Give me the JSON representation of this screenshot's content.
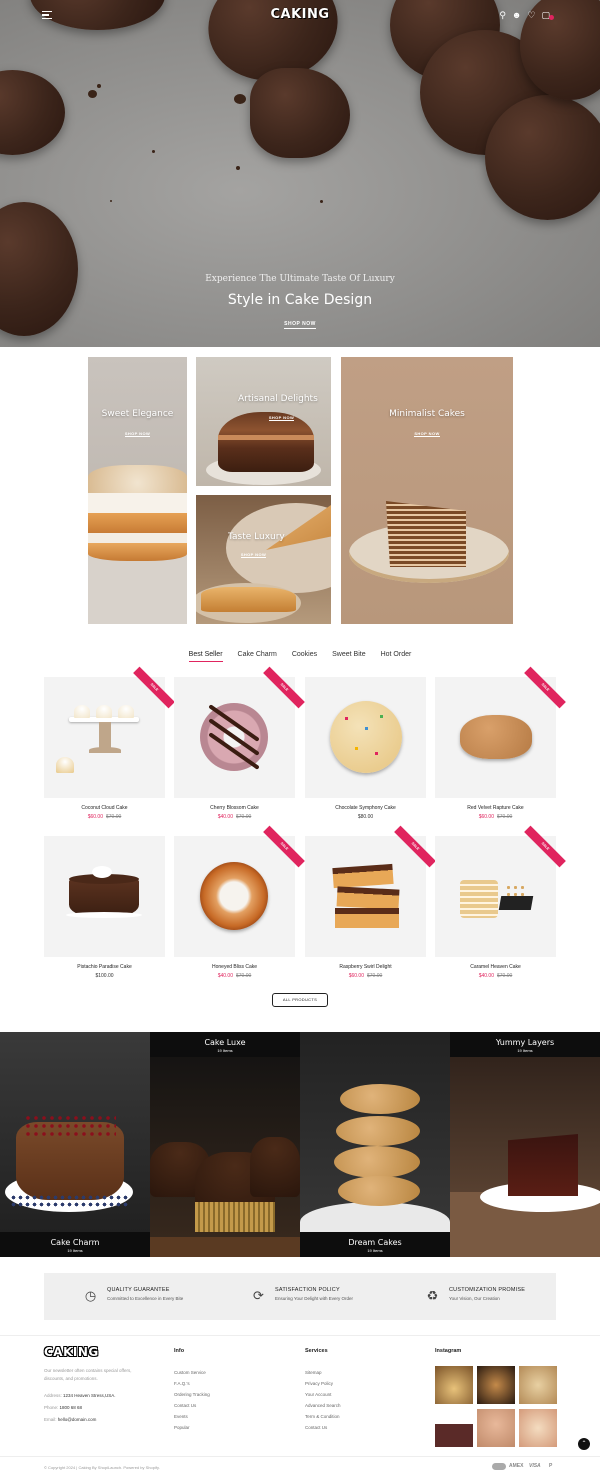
{
  "header": {
    "logo": "CAKING",
    "menu_icon": "hamburger-icon",
    "icons": [
      "search-icon",
      "user-icon",
      "heart-icon",
      "cart-icon"
    ]
  },
  "hero": {
    "subtitle": "Experience The Ultimate Taste Of Luxury",
    "title": "Style in Cake Design",
    "button": "SHOP NOW"
  },
  "banners": [
    {
      "title": "Sweet Elegance",
      "button": "SHOP NOW"
    },
    {
      "title": "Artisanal Delights",
      "button": "SHOP NOW"
    },
    {
      "title": "Taste Luxury",
      "button": "SHOP NOW"
    },
    {
      "title": "Minimalist Cakes",
      "button": "SHOP NOW"
    }
  ],
  "tabs": [
    "Best Seller",
    "Cake Charm",
    "Cookies",
    "Sweet Bite",
    "Hot Order"
  ],
  "active_tab": "Best Seller",
  "sale_label": "SALE",
  "products": [
    {
      "name": "Coconut Cloud Cake",
      "price": "$60.00",
      "old_price": "$70.00",
      "sale": true
    },
    {
      "name": "Cherry Blossom Cake",
      "price": "$40.00",
      "old_price": "$70.00",
      "sale": true
    },
    {
      "name": "Chocolate Symphony Cake",
      "price": "$80.00",
      "old_price": "",
      "sale": false
    },
    {
      "name": "Red Velvet Rapture Cake",
      "price": "$60.00",
      "old_price": "$70.00",
      "sale": true
    },
    {
      "name": "Pistachio Paradise Cake",
      "price": "$100.00",
      "old_price": "",
      "sale": false
    },
    {
      "name": "Honeyed Bliss Cake",
      "price": "$40.00",
      "old_price": "$70.00",
      "sale": true
    },
    {
      "name": "Raspberry Swirl Delight",
      "price": "$60.00",
      "old_price": "$70.00",
      "sale": true
    },
    {
      "name": "Caramel Heaven Cake",
      "price": "$40.00",
      "old_price": "$70.00",
      "sale": true
    }
  ],
  "all_products_button": "ALL PRODUCTS",
  "collections": [
    {
      "title": "Cake Charm",
      "count": "19 Items"
    },
    {
      "title": "Cake Luxe",
      "count": "19 Items"
    },
    {
      "title": "Dream Cakes",
      "count": "19 Items"
    },
    {
      "title": "Yummy Layers",
      "count": "19 Items"
    }
  ],
  "policies": [
    {
      "title": "QUALITY GUARANTEE",
      "subtitle": "Committed to Excellence in Every Bite",
      "icon": "clock-icon"
    },
    {
      "title": "SATISFACTION POLICY",
      "subtitle": "Ensuring Your Delight with Every Order",
      "icon": "refresh-icon"
    },
    {
      "title": "CUSTOMIZATION PROMISE",
      "subtitle": "Your Vision, Our Creation",
      "icon": "cake-icon"
    }
  ],
  "footer": {
    "logo": "CAKING",
    "description": "Our newsletter often contains special offers, discounts, and promotions.",
    "address_label": "Address:",
    "address": "1234 Heaven Stress,USA.",
    "phone_label": "Phone:",
    "phone": "1800 68 68",
    "email_label": "Email:",
    "email": "hello@domain.com",
    "info_title": "Info",
    "info_links": [
      "Custom Service",
      "F.A.Q.'s",
      "Ordering Tracking",
      "Contact Us",
      "Events",
      "Popular"
    ],
    "services_title": "Services",
    "services_links": [
      "Sitemap",
      "Privacy Policy",
      "Your Account",
      "Advanced Search",
      "Term & Condition",
      "Contact Us"
    ],
    "instagram_title": "Instagram",
    "copyright": "© Copyright 2024 | Caking By ShopiLaunch. Powered by Shopify.",
    "payments": [
      "AMEX",
      "VISA",
      "P"
    ]
  }
}
